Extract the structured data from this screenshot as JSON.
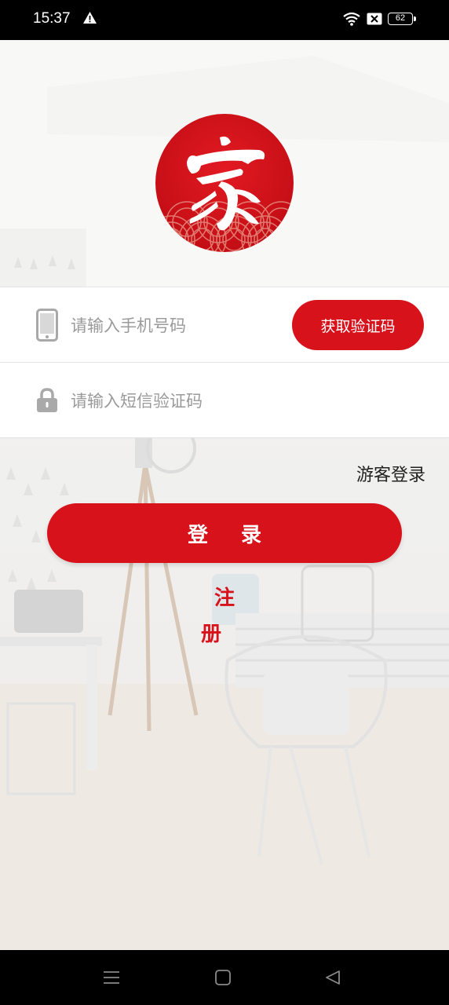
{
  "status_bar": {
    "time": "15:37",
    "battery_level": "62",
    "icons": [
      "warning-icon",
      "wifi-icon",
      "sim-blocked-icon",
      "battery-icon"
    ]
  },
  "brand": {
    "logo_icon": "logo-jia-icon",
    "accent_color": "#d7121b"
  },
  "form": {
    "phone": {
      "icon": "phone-icon",
      "placeholder": "请输入手机号码",
      "value": ""
    },
    "get_code_label": "获取验证码",
    "code": {
      "icon": "lock-icon",
      "placeholder": "请输入短信验证码",
      "value": ""
    }
  },
  "guest_login_label": "游客登录",
  "login_label": "登录",
  "register_label": "注册",
  "nav_bar": {
    "icons": [
      "menu-icon",
      "home-icon",
      "back-icon"
    ]
  }
}
